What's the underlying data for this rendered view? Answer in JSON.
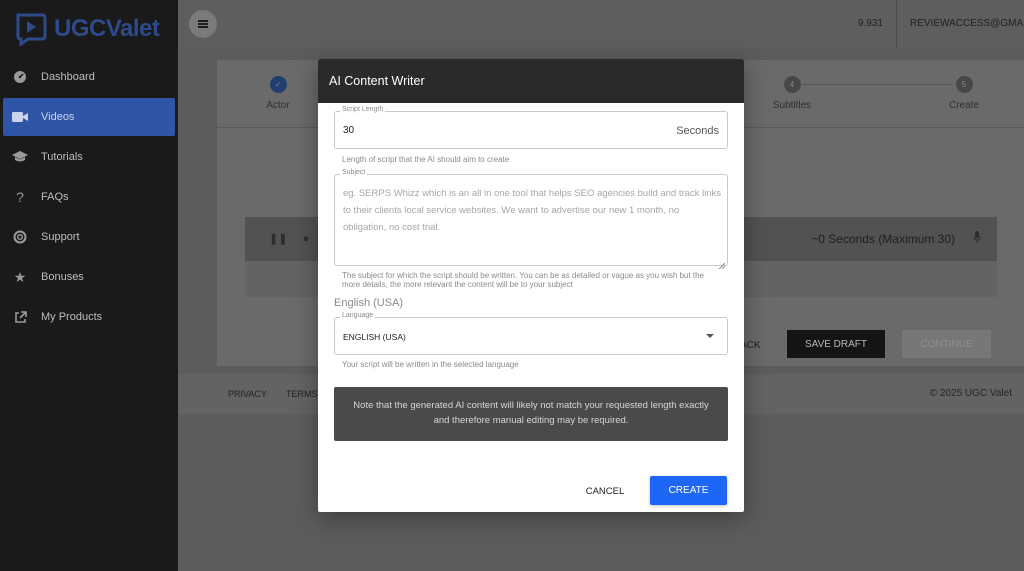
{
  "colors": {
    "accent": "#1e66f5",
    "sidebar_active": "#2f55a6",
    "logo": "#2d4a8a"
  },
  "brand": {
    "name": "UGCValet"
  },
  "sidebar": {
    "items": [
      {
        "label": "Dashboard",
        "icon": "speedometer-icon"
      },
      {
        "label": "Videos",
        "icon": "video-camera-icon",
        "active": true
      },
      {
        "label": "Tutorials",
        "icon": "graduation-cap-icon"
      },
      {
        "label": "FAQs",
        "icon": "question-icon"
      },
      {
        "label": "Support",
        "icon": "lifebuoy-icon"
      },
      {
        "label": "Bonuses",
        "icon": "star-icon"
      },
      {
        "label": "My Products",
        "icon": "external-link-icon"
      }
    ]
  },
  "topbar": {
    "credits": "9.931",
    "account": "REVIEWACCESS@GMAIL.C"
  },
  "steps": [
    {
      "label": "Actor",
      "number": "",
      "done": true
    },
    {
      "label": "Subtitles",
      "number": "4"
    },
    {
      "label": "Create",
      "number": "5"
    }
  ],
  "background": {
    "audio_duration": "~0 Seconds (Maximum 30)",
    "back_label": "ACK",
    "save_draft_label": "SAVE DRAFT",
    "continue_label": "CONTINUE"
  },
  "footer": {
    "privacy": "PRIVACY",
    "terms": "TERMS",
    "copyright": "© 2025 UGC Valet"
  },
  "modal": {
    "title": "AI Content Writer",
    "script_length": {
      "legend": "Script Length",
      "value": "30",
      "unit": "Seconds",
      "help": "Length of script that the AI should aim to create"
    },
    "subject": {
      "legend": "Subject",
      "placeholder": "eg. SERPS Whizz which is an all in one tool that helps SEO agencies build and track links to their clients local service websites. We want to advertise our new 1 month, no obligation, no cost trial.",
      "help": "The subject for which the script should be written. You can be as detailed or vague as you wish but the more details, the more relevant the content will be to your subject"
    },
    "language_section": "English (USA)",
    "language": {
      "legend": "Language",
      "value": "ENGLISH (USA)",
      "help": "Your script will be written in the selected language"
    },
    "note": "Note that the generated AI content will likely not match your requested length exactly and therefore manual editing may be required.",
    "cancel_label": "CANCEL",
    "create_label": "CREATE"
  }
}
